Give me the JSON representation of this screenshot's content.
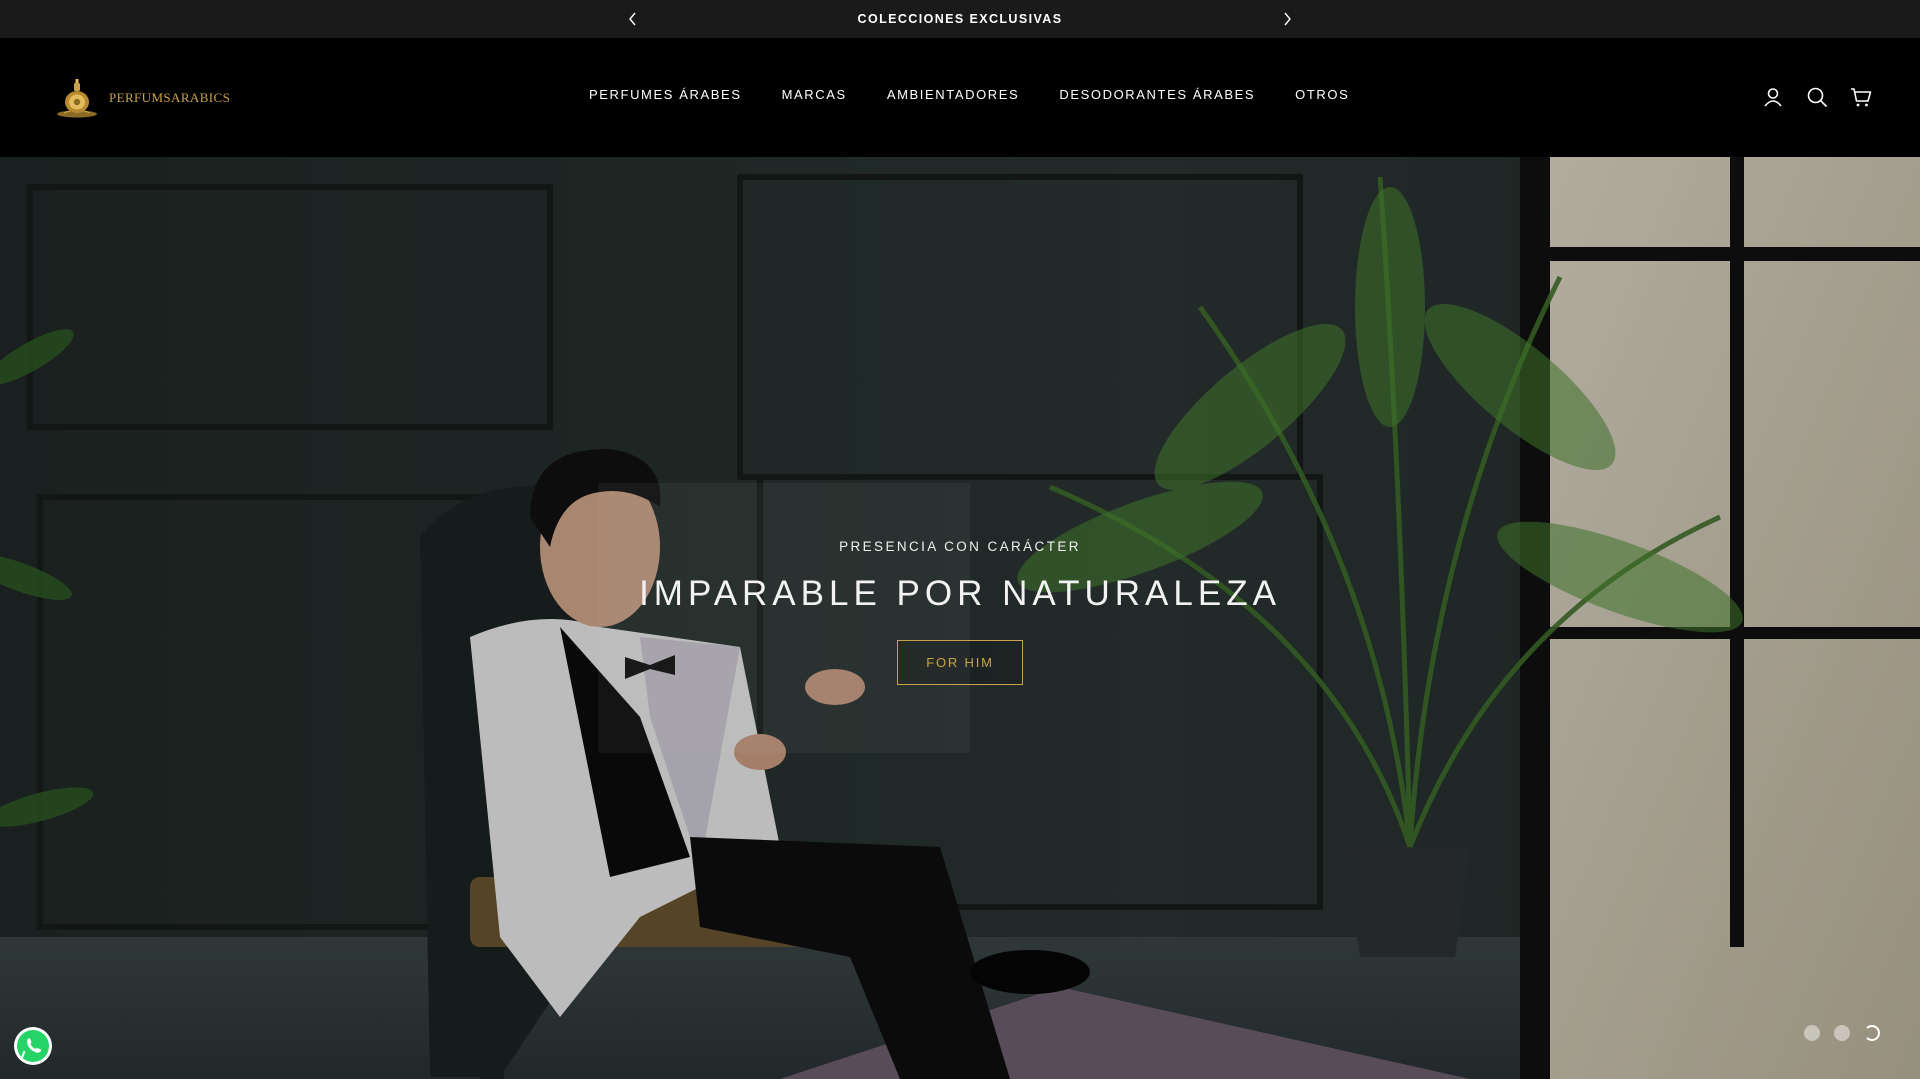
{
  "announcement": {
    "text": "COLECCIONES EXCLUSIVAS",
    "prev_icon": "chevron-left-icon",
    "next_icon": "chevron-right-icon"
  },
  "header": {
    "brand": "PERFUMSARABICS",
    "nav": [
      {
        "label": "PERFUMES ÁRABES"
      },
      {
        "label": "MARCAS"
      },
      {
        "label": "AMBIENTADORES"
      },
      {
        "label": "DESODORANTES ÁRABES"
      },
      {
        "label": "OTROS"
      }
    ],
    "icons": [
      "account-icon",
      "search-icon",
      "cart-icon"
    ]
  },
  "hero": {
    "eyebrow": "PRESENCIA CON CARÁCTER",
    "title": "IMPARABLE POR NATURALEZA",
    "cta": "FOR HIM",
    "slides": 3,
    "active_slide": 3
  },
  "colors": {
    "accent_gold": "#c9a24b",
    "header_bg": "#000000",
    "announcement_bg": "#1a1a1a"
  },
  "floating": {
    "whatsapp_icon": "whatsapp-icon"
  }
}
